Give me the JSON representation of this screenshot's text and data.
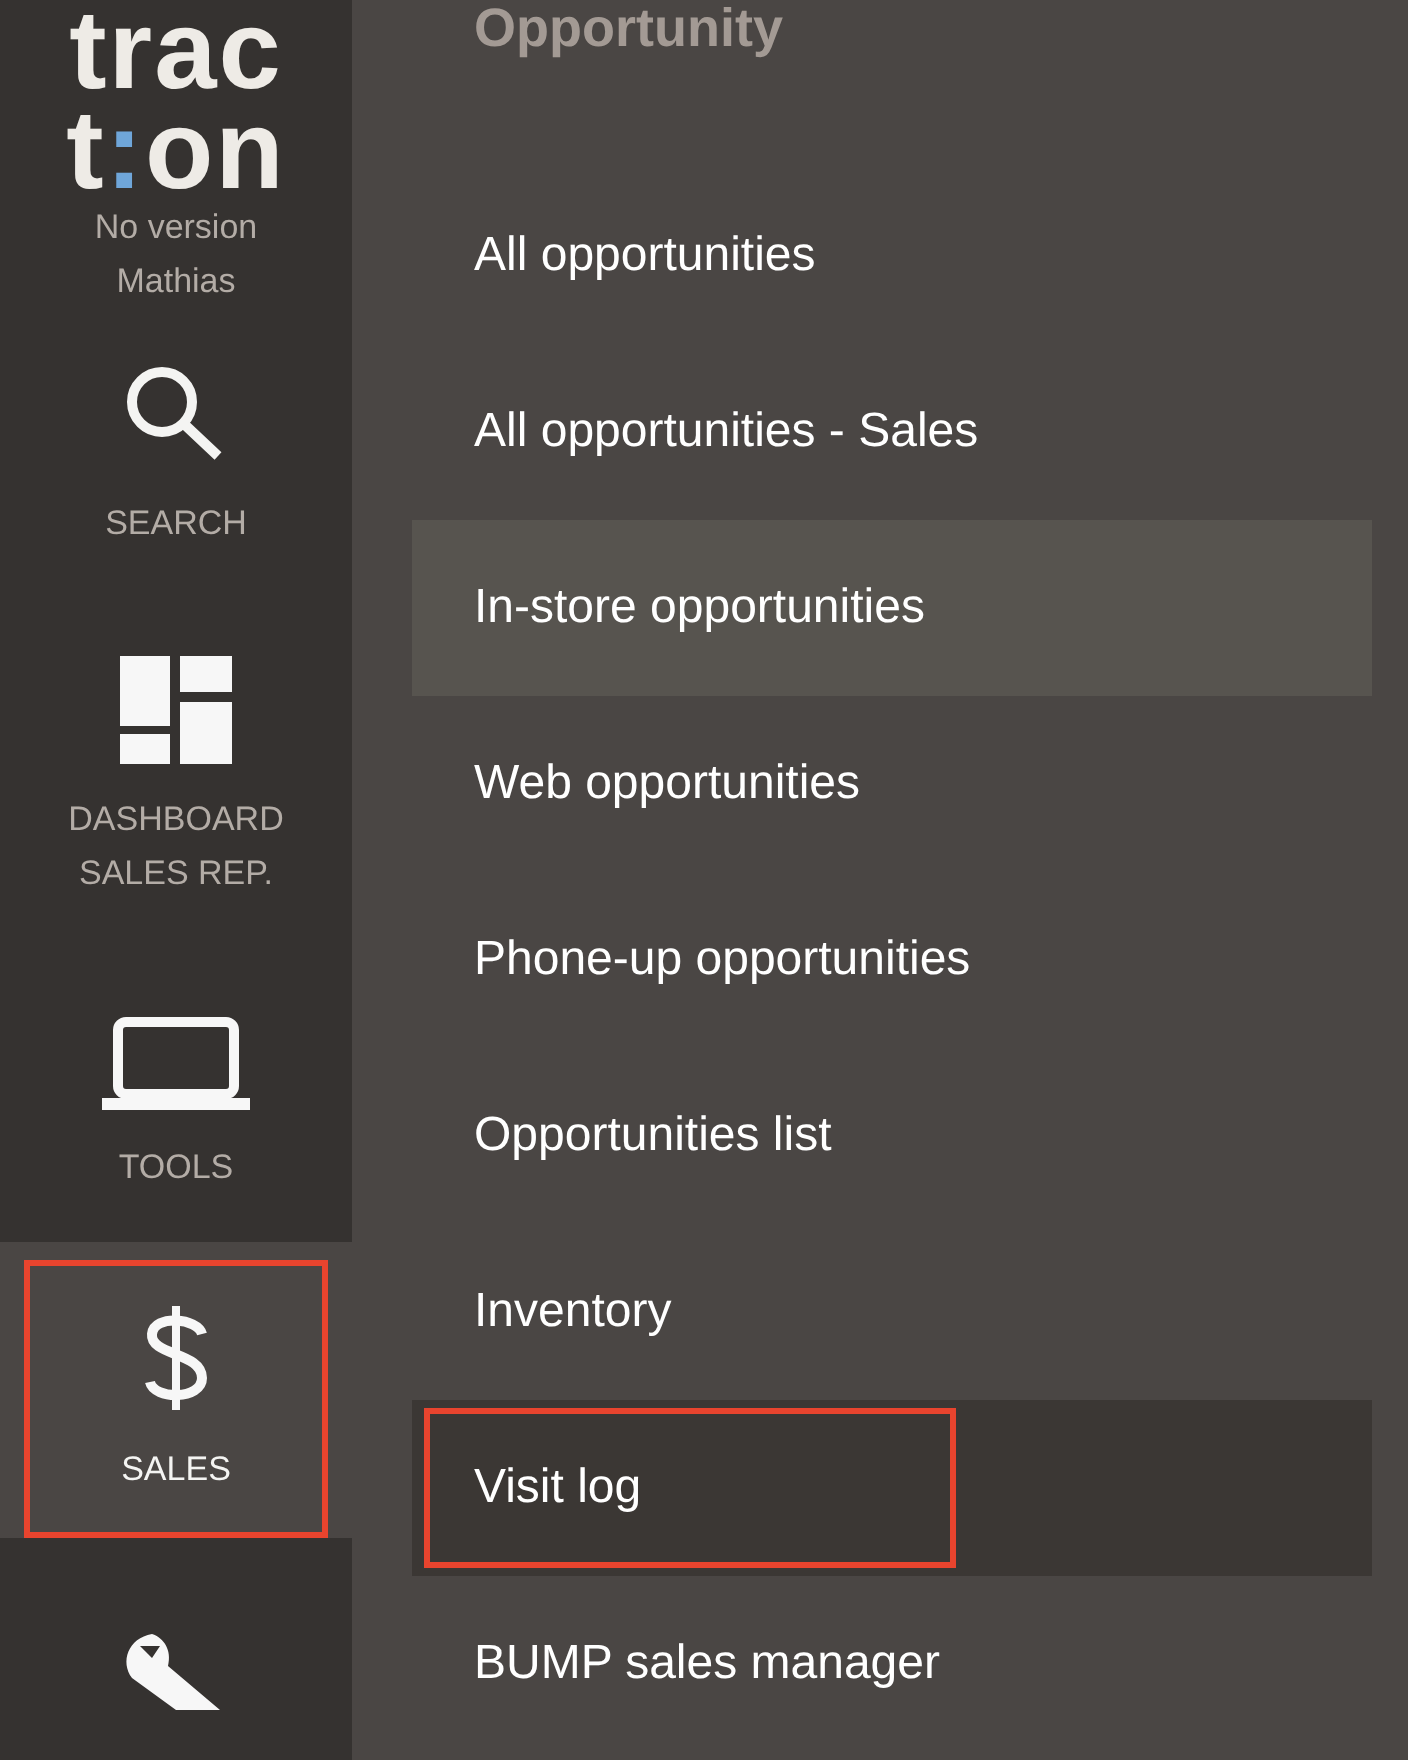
{
  "sidebar": {
    "logo": {
      "line1": "trac",
      "line2": [
        {
          "text": "t",
          "color": "#eeebe6"
        },
        {
          "text": ":",
          "color": "#6fa6d9"
        },
        {
          "text": "on",
          "color": "#eeebe6"
        }
      ]
    },
    "version": "No version",
    "user": "Mathias",
    "items": [
      {
        "labels": [
          "SEARCH"
        ],
        "selected": false,
        "highlighted": false
      },
      {
        "labels": [
          "DASHBOARD",
          "SALES REP."
        ],
        "selected": false,
        "highlighted": false
      },
      {
        "labels": [
          "TOOLS"
        ],
        "selected": false,
        "highlighted": false
      },
      {
        "labels": [
          "SALES"
        ],
        "selected": true,
        "highlighted": true
      },
      {
        "selected": false,
        "highlighted": false
      }
    ]
  },
  "menu": {
    "heading": "Opportunity",
    "items": [
      {
        "label": "All opportunities",
        "selected": false,
        "hovered": false,
        "highlighted": false
      },
      {
        "label": "All opportunities - Sales",
        "selected": false,
        "hovered": false,
        "highlighted": false
      },
      {
        "label": "In-store opportunities",
        "selected": false,
        "hovered": true,
        "highlighted": false
      },
      {
        "label": "Web opportunities",
        "selected": false,
        "hovered": false,
        "highlighted": false
      },
      {
        "label": "Phone-up opportunities",
        "selected": false,
        "hovered": false,
        "highlighted": false
      },
      {
        "label": "Opportunities list",
        "selected": false,
        "hovered": false,
        "highlighted": false
      },
      {
        "label": "Inventory",
        "selected": false,
        "hovered": false,
        "highlighted": false
      },
      {
        "label": "Visit log",
        "selected": true,
        "hovered": false,
        "highlighted": true
      },
      {
        "label": "BUMP sales manager",
        "selected": false,
        "hovered": false,
        "highlighted": false
      }
    ]
  }
}
